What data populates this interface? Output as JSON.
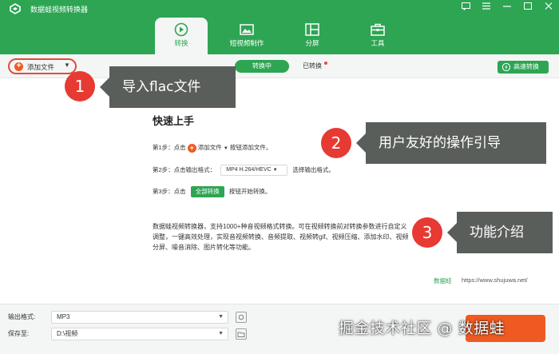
{
  "app": {
    "title": "数据蛙视频转换器"
  },
  "tabs": [
    {
      "label": "转换",
      "icon": "convert-icon",
      "active": true
    },
    {
      "label": "短视频制作",
      "icon": "short-video-icon",
      "active": false
    },
    {
      "label": "分屏",
      "icon": "split-screen-icon",
      "active": false
    },
    {
      "label": "工具",
      "icon": "toolbox-icon",
      "active": false
    }
  ],
  "toolbar": {
    "add_file_label": "添加文件",
    "converting_label": "转换中",
    "converted_label": "已转换",
    "fast_convert_label": "高速转换"
  },
  "quick_start": {
    "title": "快速上手",
    "step1_prefix": "第1步：点击",
    "step1_button": "添加文件",
    "step1_suffix": "按钮添加文件。",
    "step2_prefix": "第2步：点击输出格式：",
    "step2_format": "MP4 H.264/HEVC",
    "step2_suffix": "选择输出格式。",
    "step3_prefix": "第3步：点击",
    "step3_button": "全部转换",
    "step3_suffix": "按钮开始转换。"
  },
  "description": "数据蛙视频转换器，支持1000+种音视频格式转换。可在视频转换前对转换参数进行自定义调整，一键高效处理，实现音视频转换、音频提取、视频转gif、视频压缩、添加水印、视频分屏、噪音消除、图片转化等功能。",
  "brand_watermark": {
    "name": "数据蛙",
    "url": "https://www.shujuwa.net/"
  },
  "callouts": [
    {
      "number": "1",
      "text": "导入flac文件"
    },
    {
      "number": "2",
      "text": "用户友好的操作引导"
    },
    {
      "number": "3",
      "text": "功能介绍"
    }
  ],
  "bottom": {
    "output_format_label": "输出格式:",
    "output_format_value": "MP3",
    "save_to_label": "保存至:",
    "save_to_value": "D:\\视频"
  },
  "footer_watermark": "掘金技术社区 @ 数据蛙",
  "colors": {
    "brand_green": "#2da553",
    "accent_orange": "#f05a22",
    "callout_red": "#e63a32",
    "callout_gray": "#5a5e5b"
  }
}
